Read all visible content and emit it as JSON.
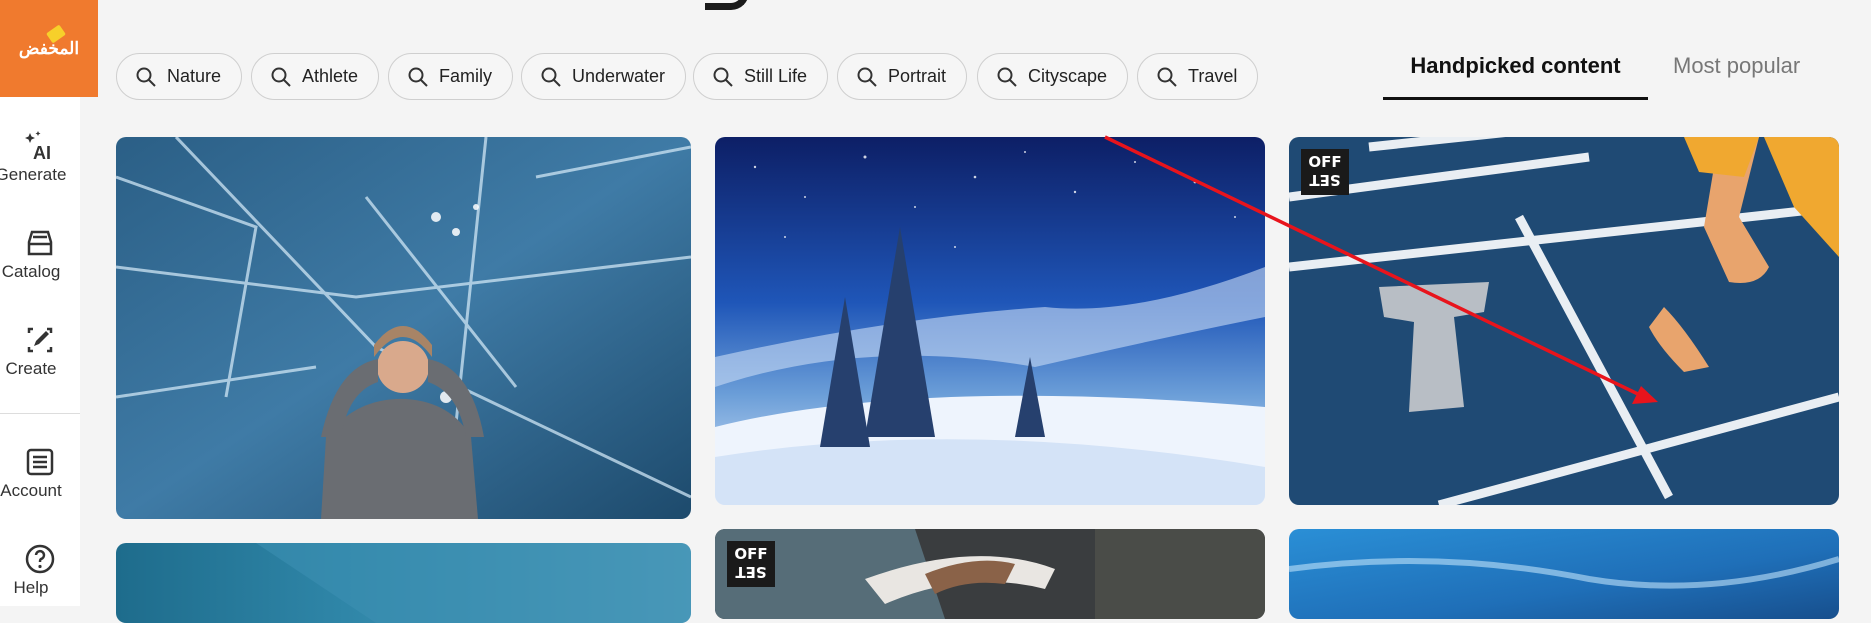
{
  "app": {
    "logo_text": "المخفض"
  },
  "sidebar": {
    "items": [
      {
        "label": "Generate",
        "icon": "ai-sparkle-icon"
      },
      {
        "label": "Catalog",
        "icon": "catalog-icon"
      },
      {
        "label": "Create",
        "icon": "create-edit-icon"
      },
      {
        "label": "Account",
        "icon": "account-icon"
      },
      {
        "label": "Help",
        "icon": "help-icon"
      }
    ]
  },
  "chips": [
    "Nature",
    "Athlete",
    "Family",
    "Underwater",
    "Still Life",
    "Portrait",
    "Cityscape",
    "Travel"
  ],
  "tabs": {
    "active": "Handpicked content",
    "inactive": "Most popular"
  },
  "cards": {
    "ice_woman": {
      "desc": ""
    },
    "winter_night": {
      "desc": ""
    },
    "track": {
      "badge_top": "OFF",
      "badge_bottom": "SET"
    },
    "row2_middle": {
      "badge_top": "OFF",
      "badge_bottom": "SET"
    }
  },
  "colors": {
    "brand": "#f07a2e",
    "annotation_arrow": "#e8141c"
  }
}
